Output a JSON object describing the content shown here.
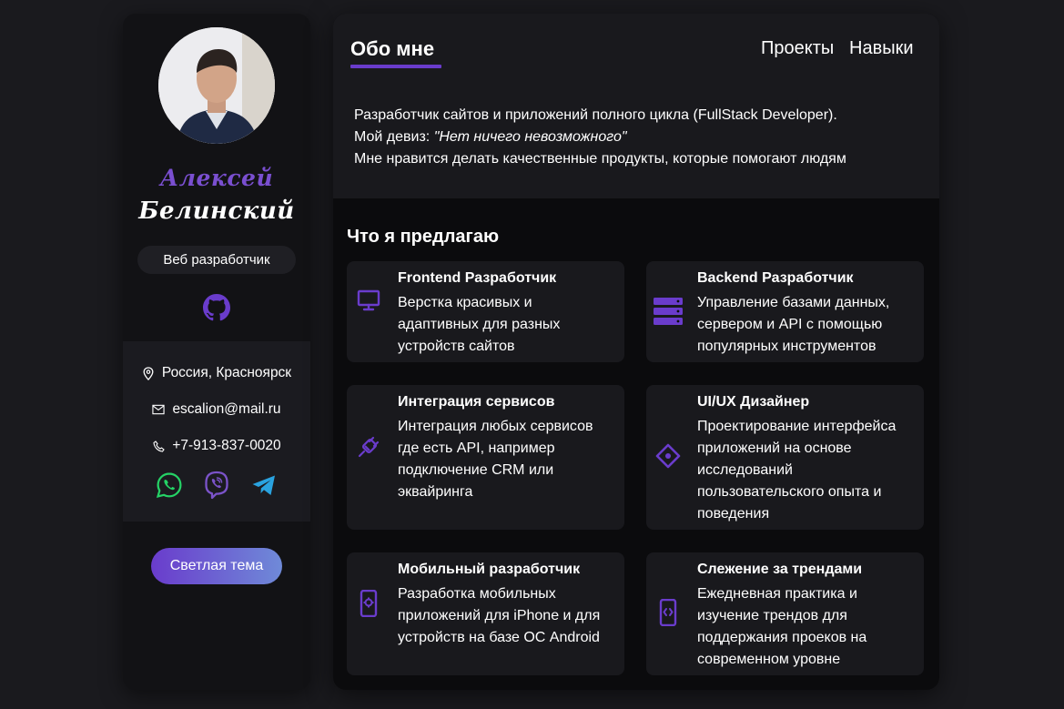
{
  "profile": {
    "first_name": "Алексей",
    "last_name": "Белинский",
    "role": "Веб разработчик",
    "github_icon": "github-icon",
    "avatar_icon": "avatar-photo"
  },
  "contacts": {
    "location": "Россия, Красноярск",
    "email": "escalion@mail.ru",
    "phone": "+7-913-837-0020",
    "messengers": [
      "whatsapp-icon",
      "viber-icon",
      "telegram-icon"
    ]
  },
  "theme_button": {
    "label": "Светлая тема"
  },
  "nav": {
    "active_tab": "Обо мне",
    "tabs": [
      "Проекты",
      "Навыки"
    ]
  },
  "about": {
    "line1": "Разработчик сайтов и приложений полного цикла (FullStack Developer).",
    "motto_prefix": "Мой девиз: ",
    "motto": "\"Нет ничего невозможного\"",
    "line3": "Мне нравится делать качественные продукты, которые помогают людям"
  },
  "offers": {
    "title": "Что я предлагаю",
    "items": [
      {
        "title": "Frontend Разработчик",
        "text": "Верстка красивых и адаптивных для разных устройств сайтов",
        "icon": "monitor-icon"
      },
      {
        "title": "Backend Разработчик",
        "text": "Управление базами данных, сервером и API с помощью популярных инструментов",
        "icon": "server-icon"
      },
      {
        "title": "Интеграция сервисов",
        "text": "Интеграция любых сервисов где есть API, например подключение CRM или эквайринга",
        "icon": "plug-icon"
      },
      {
        "title": "UI/UX Дизайнер",
        "text": "Проектирование интерфейса приложений на основе исследований пользовательского опыта и поведения",
        "icon": "design-icon"
      },
      {
        "title": "Мобильный разработчик",
        "text": "Разработка мобильных приложений для iPhone и для устройств на базе ОС Android",
        "icon": "mobile-settings-icon"
      },
      {
        "title": "Слежение за трендами",
        "text": "Ежедневная практика и изучение трендов для поддержания проеков на современном уровне",
        "icon": "mobile-code-icon"
      }
    ]
  },
  "colors": {
    "accent": "#6a3ccc",
    "whatsapp": "#25d366",
    "telegram": "#2aa3e0"
  }
}
